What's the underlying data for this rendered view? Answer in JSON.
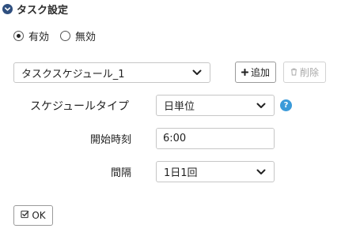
{
  "section": {
    "title": "タスク設定"
  },
  "status": {
    "options": [
      {
        "label": "有効",
        "checked": true
      },
      {
        "label": "無効",
        "checked": false
      }
    ]
  },
  "schedule": {
    "selected": "タスクスケジュール_1",
    "add_label": "追加",
    "delete_label": "削除"
  },
  "form": {
    "type_label": "スケジュールタイプ",
    "type_value": "日単位",
    "start_label": "開始時刻",
    "start_value": "6:00",
    "interval_label": "間隔",
    "interval_value": "1日1回"
  },
  "help_glyph": "?",
  "ok_label": "OK"
}
